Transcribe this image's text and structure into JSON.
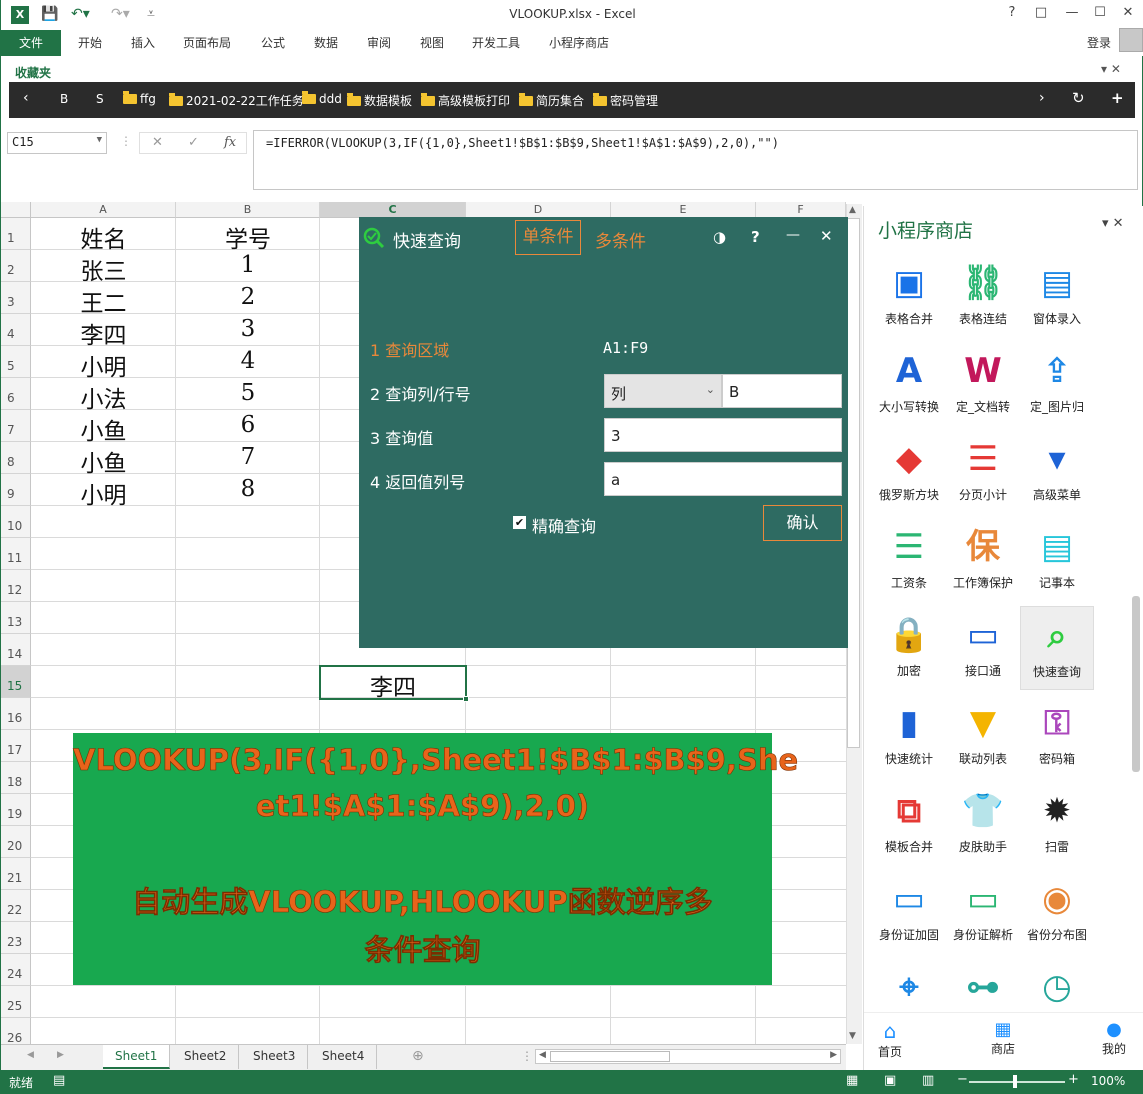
{
  "titlebar": {
    "title": "VLOOKUP.xlsx - Excel",
    "help": "?",
    "restore": "□",
    "minimize": "—",
    "maximize": "☐",
    "close": "✕"
  },
  "ribbon": {
    "file": "文件",
    "tabs": [
      "开始",
      "插入",
      "页面布局",
      "公式",
      "数据",
      "审阅",
      "视图",
      "开发工具",
      "小程序商店"
    ],
    "login": "登录"
  },
  "favorites": {
    "label": "收藏夹",
    "close": "▾ ✕",
    "nav_back": "‹",
    "b": "B",
    "s": "S",
    "folders": [
      "ffg",
      "2021-02-22工作任务",
      "ddd",
      "数据模板",
      "高级模板打印",
      "简历集合",
      "密码管理"
    ],
    "nav_next": "›",
    "refresh": "↻",
    "add": "+"
  },
  "formula_bar": {
    "name_box": "C15",
    "cancel": "✕",
    "enter": "✓",
    "fx": "fx",
    "formula": "=IFERROR(VLOOKUP(3,IF({1,0},Sheet1!$B$1:$B$9,Sheet1!$A$1:$A$9),2,0),\"\")"
  },
  "grid": {
    "columns": [
      "A",
      "B",
      "C",
      "D",
      "E",
      "F"
    ],
    "rows": [
      "1",
      "2",
      "3",
      "4",
      "5",
      "6",
      "7",
      "8",
      "9",
      "10",
      "11",
      "12",
      "13",
      "14",
      "15",
      "16",
      "17",
      "18",
      "19",
      "20",
      "21",
      "22",
      "23",
      "24",
      "25",
      "26"
    ],
    "colA": [
      "姓名",
      "张三",
      "王二",
      "李四",
      "小明",
      "小法",
      "小鱼",
      "小鱼",
      "小明"
    ],
    "colB": [
      "学号",
      "1",
      "2",
      "3",
      "4",
      "5",
      "6",
      "7",
      "8"
    ],
    "c15": "李四"
  },
  "dialog": {
    "title": "快速查询",
    "tab_single": "单条件",
    "tab_multi": "多条件",
    "theme": "◑",
    "help": "?",
    "minimize": "—",
    "close": "✕",
    "row1_label": "1 查询区域",
    "row1_value": "A1:F9",
    "row2_label": "2 查询列/行号",
    "row2_select": "列",
    "row2_input": "B",
    "row3_label": "3 查询值",
    "row3_input": "3",
    "row4_label": "4 返回值列号",
    "row4_input": "a",
    "exact_label": "精确查询",
    "confirm": "确认"
  },
  "banner": {
    "line1": "VLOOKUP(3,IF({1,0},Sheet1!$B$1:$B$9,She",
    "line2": "et1!$A$1:$A$9),2,0)",
    "line3": "自动生成VLOOKUP,HLOOKUP函数逆序多",
    "line4": "条件查询"
  },
  "panel": {
    "title": "小程序商店",
    "close": "▾ ✕",
    "apps": [
      "表格合并",
      "表格连结",
      "窗体录入",
      "大小写转换",
      "定_文档转",
      "定_图片归",
      "俄罗斯方块",
      "分页小计",
      "高级菜单",
      "工资条",
      "工作簿保护",
      "记事本",
      "加密",
      "接口通",
      "快速查询",
      "快速统计",
      "联动列表",
      "密码箱",
      "模板合并",
      "皮肤助手",
      "扫雷",
      "身份证加固",
      "身份证解析",
      "省份分布图",
      "",
      "",
      ""
    ],
    "nav": [
      "首页",
      "商店",
      "我的"
    ]
  },
  "sheets": [
    "Sheet1",
    "Sheet2",
    "Sheet3",
    "Sheet4"
  ],
  "status": {
    "ready": "就绪",
    "zoom": "100%"
  },
  "colors": {
    "excel_green": "#217346",
    "dialog_bg": "#2e6b62",
    "banner_bg": "#18a84f",
    "orange": "#e8641b"
  }
}
